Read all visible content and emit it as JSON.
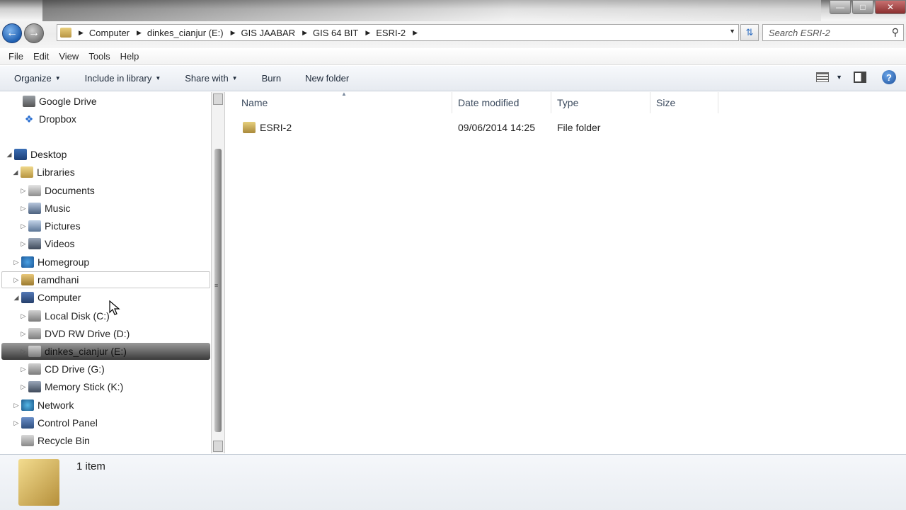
{
  "window": {
    "minimize_glyph": "—",
    "maximize_glyph": "□",
    "close_glyph": "✕"
  },
  "nav": {
    "back_glyph": "←",
    "forward_glyph": "→"
  },
  "address": {
    "crumbs": [
      "Computer",
      "dinkes_cianjur (E:)",
      "GIS JAABAR",
      "GIS 64 BIT",
      "ESRI-2"
    ]
  },
  "search": {
    "placeholder": "Search ESRI-2"
  },
  "menu": {
    "items": [
      "File",
      "Edit",
      "View",
      "Tools",
      "Help"
    ]
  },
  "commands": {
    "organize": "Organize",
    "include_library": "Include in library",
    "share_with": "Share with",
    "burn": "Burn",
    "new_folder": "New folder"
  },
  "navpane": {
    "items": [
      {
        "label": "Google Drive",
        "icon": "google-drive-icon"
      },
      {
        "label": "Dropbox",
        "icon": "dropbox-icon"
      },
      {
        "label": "Desktop",
        "icon": "desktop-icon"
      },
      {
        "label": "Libraries",
        "icon": "libraries-icon"
      },
      {
        "label": "Documents",
        "icon": "documents-icon"
      },
      {
        "label": "Music",
        "icon": "music-icon"
      },
      {
        "label": "Pictures",
        "icon": "pictures-icon"
      },
      {
        "label": "Videos",
        "icon": "videos-icon"
      },
      {
        "label": "Homegroup",
        "icon": "homegroup-icon"
      },
      {
        "label": "ramdhani",
        "icon": "user-folder-icon"
      },
      {
        "label": "Computer",
        "icon": "computer-icon"
      },
      {
        "label": "Local Disk (C:)",
        "icon": "hard-disk-icon"
      },
      {
        "label": "DVD RW Drive (D:)",
        "icon": "dvd-drive-icon"
      },
      {
        "label": "dinkes_cianjur (E:)",
        "icon": "usb-drive-icon"
      },
      {
        "label": "CD Drive (G:)",
        "icon": "cd-drive-icon"
      },
      {
        "label": "Memory Stick (K:)",
        "icon": "memory-stick-icon"
      },
      {
        "label": "Network",
        "icon": "network-icon"
      },
      {
        "label": "Control Panel",
        "icon": "control-panel-icon"
      },
      {
        "label": "Recycle Bin",
        "icon": "recycle-bin-icon"
      }
    ]
  },
  "columns": {
    "name": "Name",
    "date_modified": "Date modified",
    "type": "Type",
    "size": "Size"
  },
  "files": [
    {
      "name": "ESRI-2",
      "date_modified": "09/06/2014 14:25",
      "type": "File folder",
      "size": ""
    }
  ],
  "details": {
    "count": "1 item"
  }
}
